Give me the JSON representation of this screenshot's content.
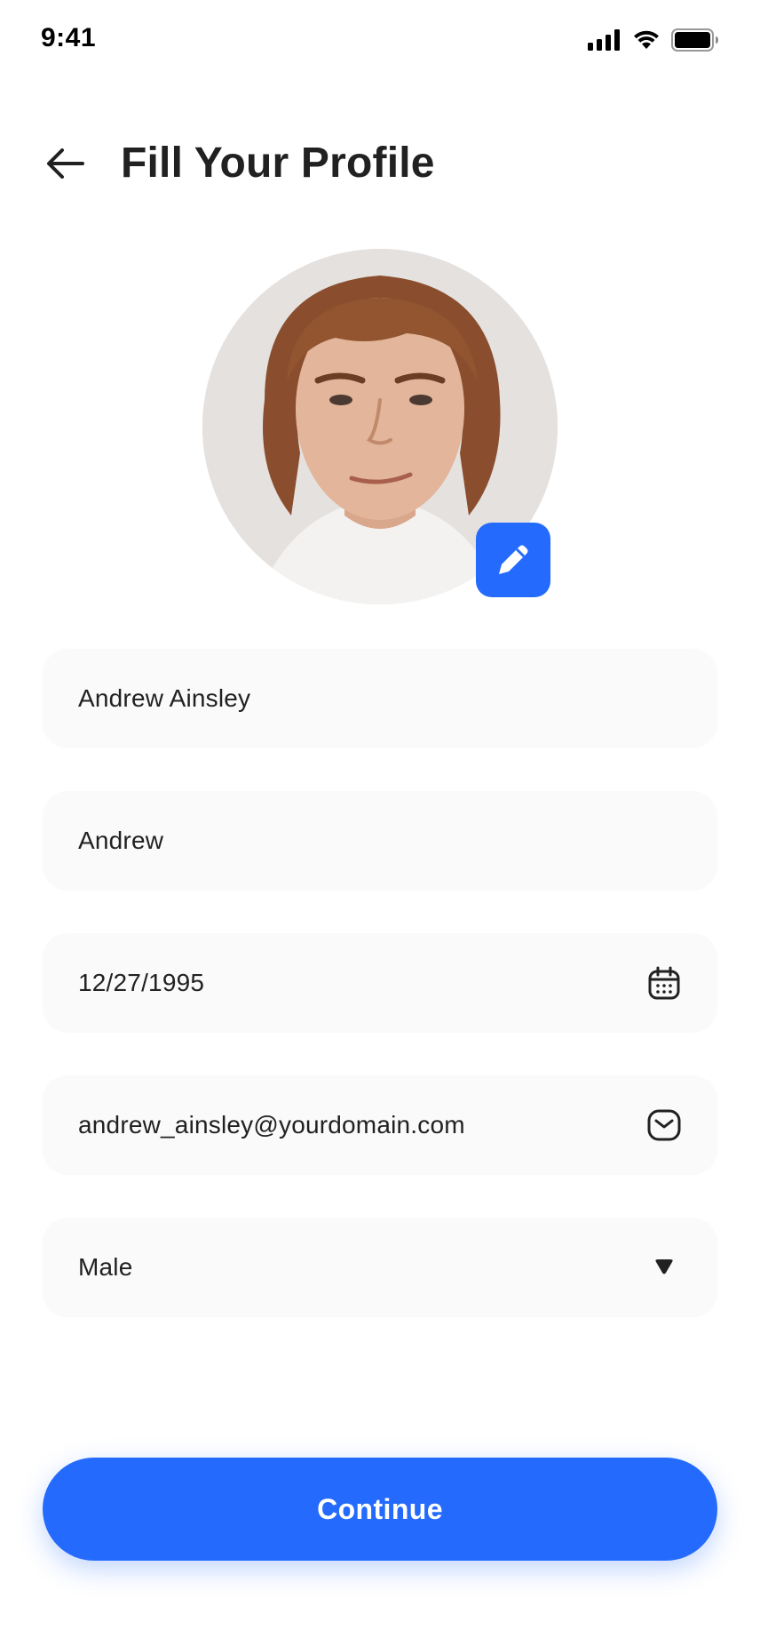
{
  "status_bar": {
    "time": "9:41"
  },
  "header": {
    "title": "Fill Your Profile"
  },
  "avatar": {
    "alt": "Profile photo"
  },
  "form": {
    "full_name": "Andrew Ainsley",
    "nickname": "Andrew",
    "date_of_birth": "12/27/1995",
    "email": "andrew_ainsley@yourdomain.com",
    "gender": "Male"
  },
  "continue_button": {
    "label": "Continue"
  },
  "colors": {
    "accent": "#246bfd",
    "field_bg": "#fafafa",
    "text": "#212121"
  },
  "icons": [
    "back-arrow-icon",
    "edit-pencil-icon",
    "calendar-icon",
    "message-icon",
    "dropdown-caret-icon",
    "signal-icon",
    "wifi-icon",
    "battery-icon"
  ]
}
